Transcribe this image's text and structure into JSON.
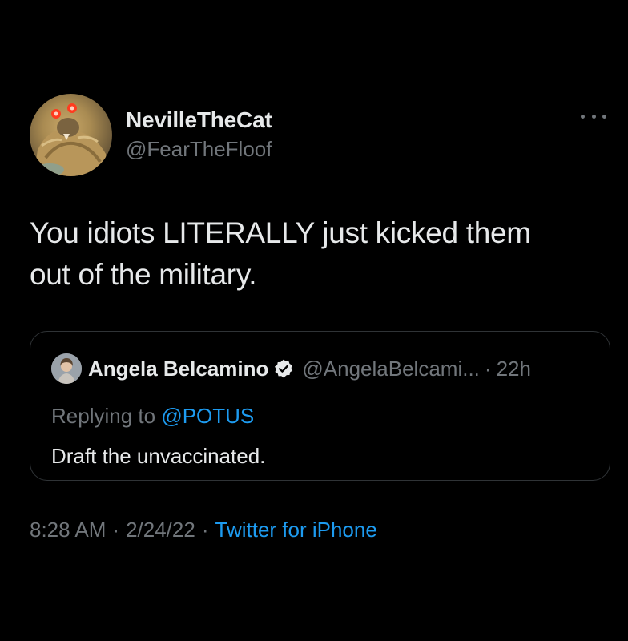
{
  "tweet": {
    "author": {
      "display_name": "NevilleTheCat",
      "handle": "@FearTheFloof"
    },
    "more_icon": "ellipsis-icon",
    "text_line1": "You idiots LITERALLY just kicked them",
    "text_line2": "out of the military.",
    "quoted": {
      "display_name": "Angela Belcamino",
      "verified_icon": "verified-badge-icon",
      "handle": "@AngelaBelcami...",
      "separator": "·",
      "time": "22h",
      "replying_prefix": "Replying to ",
      "replying_to": "@POTUS",
      "text": "Draft the unvaccinated."
    },
    "meta": {
      "time": "8:28 AM",
      "date": "2/24/22",
      "separator": "·",
      "source": "Twitter for iPhone"
    }
  },
  "colors": {
    "background": "#000000",
    "primary_text": "#e7e9ea",
    "secondary_text": "#71767b",
    "accent": "#1d9bf0",
    "border": "#2f3336"
  }
}
